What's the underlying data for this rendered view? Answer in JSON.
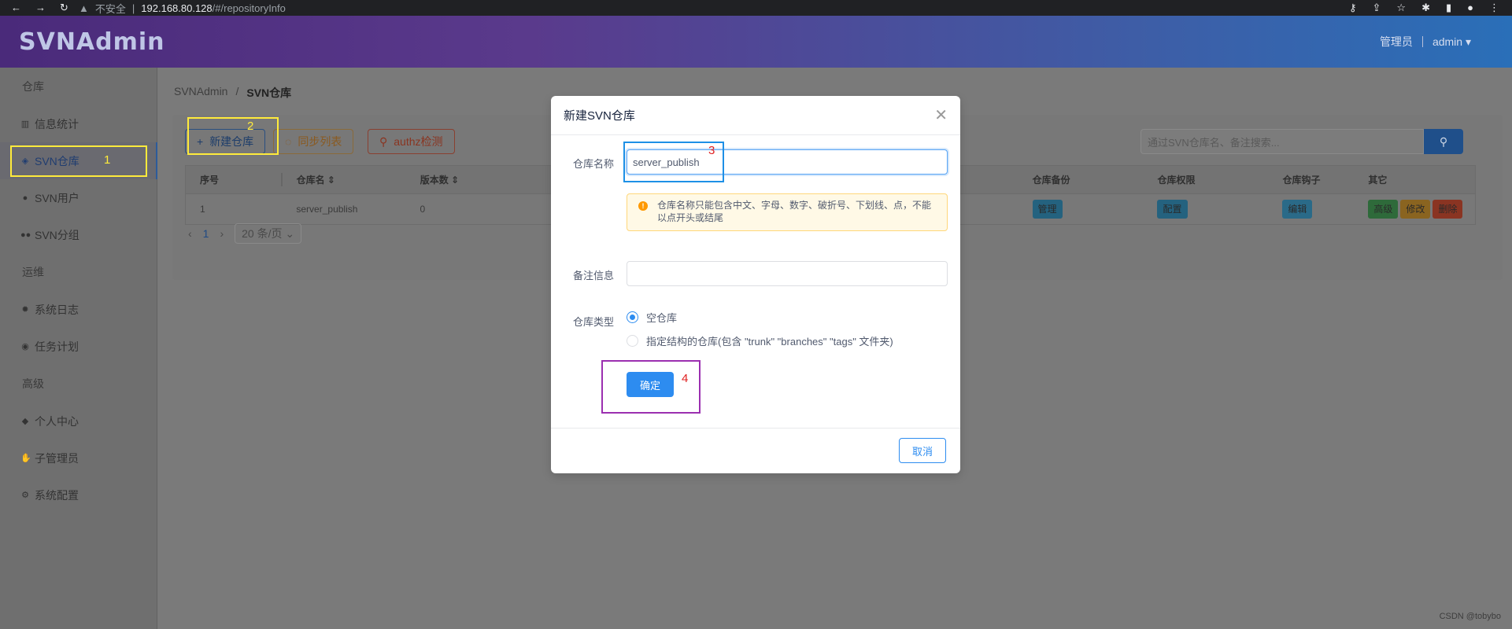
{
  "browser": {
    "security_label": "不安全",
    "url_host": "192.168.80.128",
    "url_path": "/#/repositoryInfo"
  },
  "header": {
    "logo": "SVNAdmin",
    "role": "管理员",
    "user": "admin"
  },
  "sidebar": {
    "groups": [
      {
        "label": "仓库",
        "items": [
          {
            "label": "信息统计",
            "icon": "bar-chart-icon"
          },
          {
            "label": "SVN仓库",
            "icon": "database-icon",
            "active": true
          },
          {
            "label": "SVN用户",
            "icon": "person-icon"
          },
          {
            "label": "SVN分组",
            "icon": "people-icon"
          }
        ]
      },
      {
        "label": "运维",
        "items": [
          {
            "label": "系统日志",
            "icon": "bug-icon"
          },
          {
            "label": "任务计划",
            "icon": "alarm-icon"
          }
        ]
      },
      {
        "label": "高级",
        "items": [
          {
            "label": "个人中心",
            "icon": "cube-icon"
          },
          {
            "label": "子管理员",
            "icon": "hand-icon"
          },
          {
            "label": "系统配置",
            "icon": "gear-icon"
          }
        ]
      }
    ]
  },
  "breadcrumb": {
    "root": "SVNAdmin",
    "sep": "/",
    "current": "SVN仓库"
  },
  "toolbar": {
    "new_repo": "新建仓库",
    "sync_list": "同步列表",
    "authz_check": "authz检测",
    "search_placeholder": "通过SVN仓库名、备注搜索..."
  },
  "table": {
    "headers": [
      "序号",
      "仓库名",
      "版本数",
      "仓库备份",
      "仓库权限",
      "仓库钩子",
      "其它"
    ],
    "row": {
      "index": "1",
      "name": "server_publish",
      "revisions": "0",
      "backup_btn": "管理",
      "perm_btn": "配置",
      "hook_btn": "编辑",
      "advanced_btn": "高级",
      "modify_btn": "修改",
      "delete_btn": "删除"
    }
  },
  "pager": {
    "page": "1",
    "page_size": "20 条/页"
  },
  "modal": {
    "title": "新建SVN仓库",
    "name_label": "仓库名称",
    "name_value": "server_publish",
    "tip": "仓库名称只能包含中文、字母、数字、破折号、下划线、点，不能以点开头或结尾",
    "note_label": "备注信息",
    "note_value": "",
    "type_label": "仓库类型",
    "type_option_empty": "空仓库",
    "type_option_structured": "指定结构的仓库(包含 \"trunk\" \"branches\" \"tags\" 文件夹)",
    "ok": "确定",
    "cancel": "取消"
  },
  "annotations": {
    "n1": "1",
    "n2": "2",
    "n3": "3",
    "n4": "4"
  },
  "watermark": "CSDN @tobybo",
  "colors": {
    "annotation_yellow": "#ffeb3b",
    "annotation_blue": "#1e90e6",
    "annotation_purple": "#9b2fb0",
    "annotation_red": "#e02020",
    "primary": "#2d8cf0"
  }
}
